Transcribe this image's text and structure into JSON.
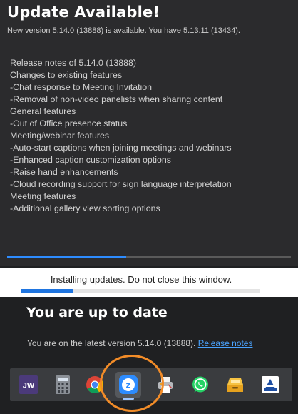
{
  "update_window": {
    "title": "Update Available!",
    "subtitle": "New version 5.14.0 (13888) is available. You have 5.13.11 (13434).",
    "release_notes": [
      "Release notes of 5.14.0 (13888)",
      "Changes to existing features",
      "-Chat response to Meeting Invitation",
      "-Removal of non-video panelists when sharing content",
      "General features",
      "-Out of Office presence status",
      "Meeting/webinar features",
      "-Auto-start captions when joining meetings and webinars",
      "-Enhanced caption customization options",
      "-Raise hand enhancements",
      "-Cloud recording support for sign language interpretation",
      "Meeting features",
      "-Additional gallery view sorting options"
    ],
    "download_progress": 0.42,
    "progress_color": "#2d8cff"
  },
  "install_window": {
    "message": "Installing updates. Do not close this window.",
    "install_progress": 0.22,
    "progress_color": "#1f75e0"
  },
  "uptodate_window": {
    "title": "You are up to date",
    "message": "You are on the latest version 5.14.0 (13888).",
    "link_label": "Release notes",
    "link_color": "#4aa3ff"
  },
  "taskbar": {
    "items": [
      {
        "icon": "jw-library-icon",
        "label": "JW"
      },
      {
        "icon": "calculator-icon"
      },
      {
        "icon": "chrome-icon"
      },
      {
        "icon": "zoom-icon",
        "active": true
      },
      {
        "icon": "printer-icon"
      },
      {
        "icon": "whatsapp-icon"
      },
      {
        "icon": "drawer-icon"
      },
      {
        "icon": "scanner-icon"
      }
    ],
    "highlight_color": "#f28c28"
  }
}
